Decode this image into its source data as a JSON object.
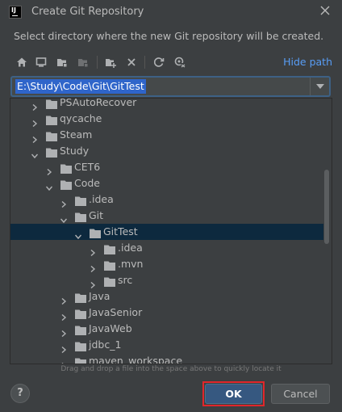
{
  "dialog": {
    "title": "Create Git Repository",
    "app_icon_text": "IJ",
    "description": "Select directory where the new Git repository will be created."
  },
  "toolbar": {
    "icons": [
      "home-icon",
      "desktop-icon",
      "project-folder-icon",
      "module-folder-icon",
      "new-folder-icon",
      "delete-icon",
      "refresh-icon",
      "show-hidden-icon"
    ],
    "hide_path_label": "Hide path"
  },
  "path": {
    "value": "E:\\Study\\Code\\Git\\GitTest"
  },
  "tree": {
    "rows": [
      {
        "label": "PSAutoRecover",
        "depth": 0,
        "expanded": false,
        "selected": false
      },
      {
        "label": "qycache",
        "depth": 0,
        "expanded": false,
        "selected": false
      },
      {
        "label": "Steam",
        "depth": 0,
        "expanded": false,
        "selected": false
      },
      {
        "label": "Study",
        "depth": 0,
        "expanded": true,
        "selected": false
      },
      {
        "label": "CET6",
        "depth": 1,
        "expanded": false,
        "selected": false
      },
      {
        "label": "Code",
        "depth": 1,
        "expanded": true,
        "selected": false
      },
      {
        "label": ".idea",
        "depth": 2,
        "expanded": false,
        "selected": false
      },
      {
        "label": "Git",
        "depth": 2,
        "expanded": true,
        "selected": false
      },
      {
        "label": "GitTest",
        "depth": 3,
        "expanded": true,
        "selected": true
      },
      {
        "label": ".idea",
        "depth": 4,
        "expanded": false,
        "selected": false
      },
      {
        "label": ".mvn",
        "depth": 4,
        "expanded": false,
        "selected": false
      },
      {
        "label": "src",
        "depth": 4,
        "expanded": false,
        "selected": false
      },
      {
        "label": "Java",
        "depth": 2,
        "expanded": false,
        "selected": false
      },
      {
        "label": "JavaSenior",
        "depth": 2,
        "expanded": false,
        "selected": false
      },
      {
        "label": "JavaWeb",
        "depth": 2,
        "expanded": false,
        "selected": false
      },
      {
        "label": "jdbc_1",
        "depth": 2,
        "expanded": false,
        "selected": false
      },
      {
        "label": "maven_workspace",
        "depth": 2,
        "expanded": false,
        "selected": false
      }
    ]
  },
  "hint": "Drag and drop a file into the space above to quickly locate it",
  "buttons": {
    "help_label": "?",
    "ok_label": "OK",
    "cancel_label": "Cancel"
  },
  "colors": {
    "background": "#3c3f41",
    "selection": "#0d293e",
    "link": "#589df6",
    "ok_button": "#365880",
    "highlight_outline": "#e0262b"
  }
}
